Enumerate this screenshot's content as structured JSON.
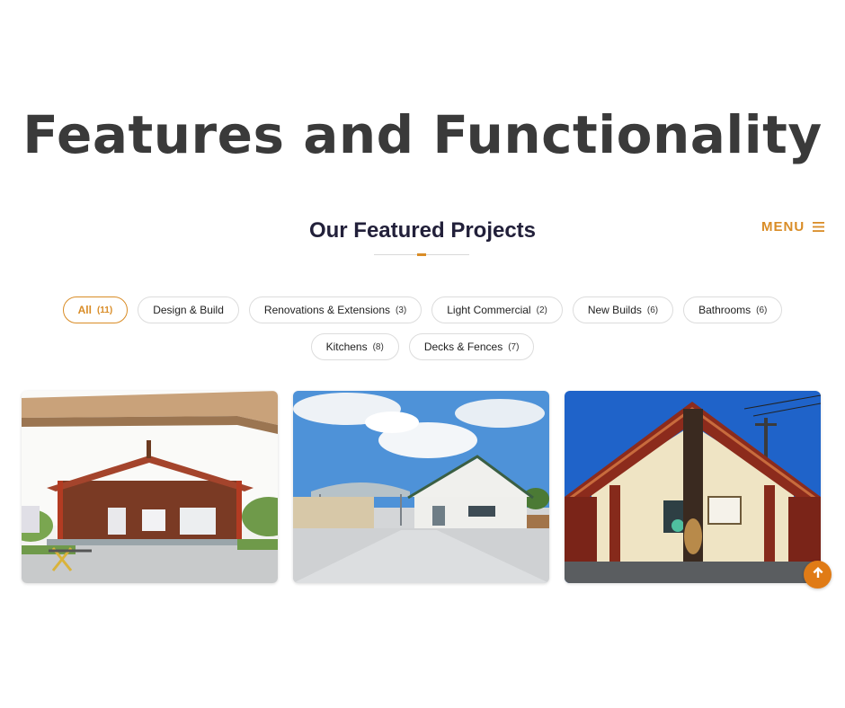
{
  "headline": "Features and Functionality",
  "section": {
    "title": "Our Featured Projects"
  },
  "menu": {
    "label": "MENU",
    "icon": "hamburger-icon"
  },
  "filters": [
    {
      "label": "All",
      "count": "(11)",
      "active": true
    },
    {
      "label": "Design & Build",
      "count": ""
    },
    {
      "label": "Renovations & Extensions",
      "count": "(3)"
    },
    {
      "label": "Light Commercial",
      "count": "(2)"
    },
    {
      "label": "New Builds",
      "count": "(6)"
    },
    {
      "label": "Bathrooms",
      "count": "(6)"
    },
    {
      "label": "Kitchens",
      "count": "(8)"
    },
    {
      "label": "Decks & Fences",
      "count": "(7)"
    }
  ],
  "projects": [
    {
      "image": "red wooden marae meeting house"
    },
    {
      "image": "white building with covered walkway"
    },
    {
      "image": "carved marae entrance with pou"
    }
  ],
  "scroll_top": {
    "icon": "arrow-up-icon"
  },
  "colors": {
    "accent": "#d98c26",
    "scroll_button": "#e07b16",
    "heading": "#3a3a3a"
  }
}
